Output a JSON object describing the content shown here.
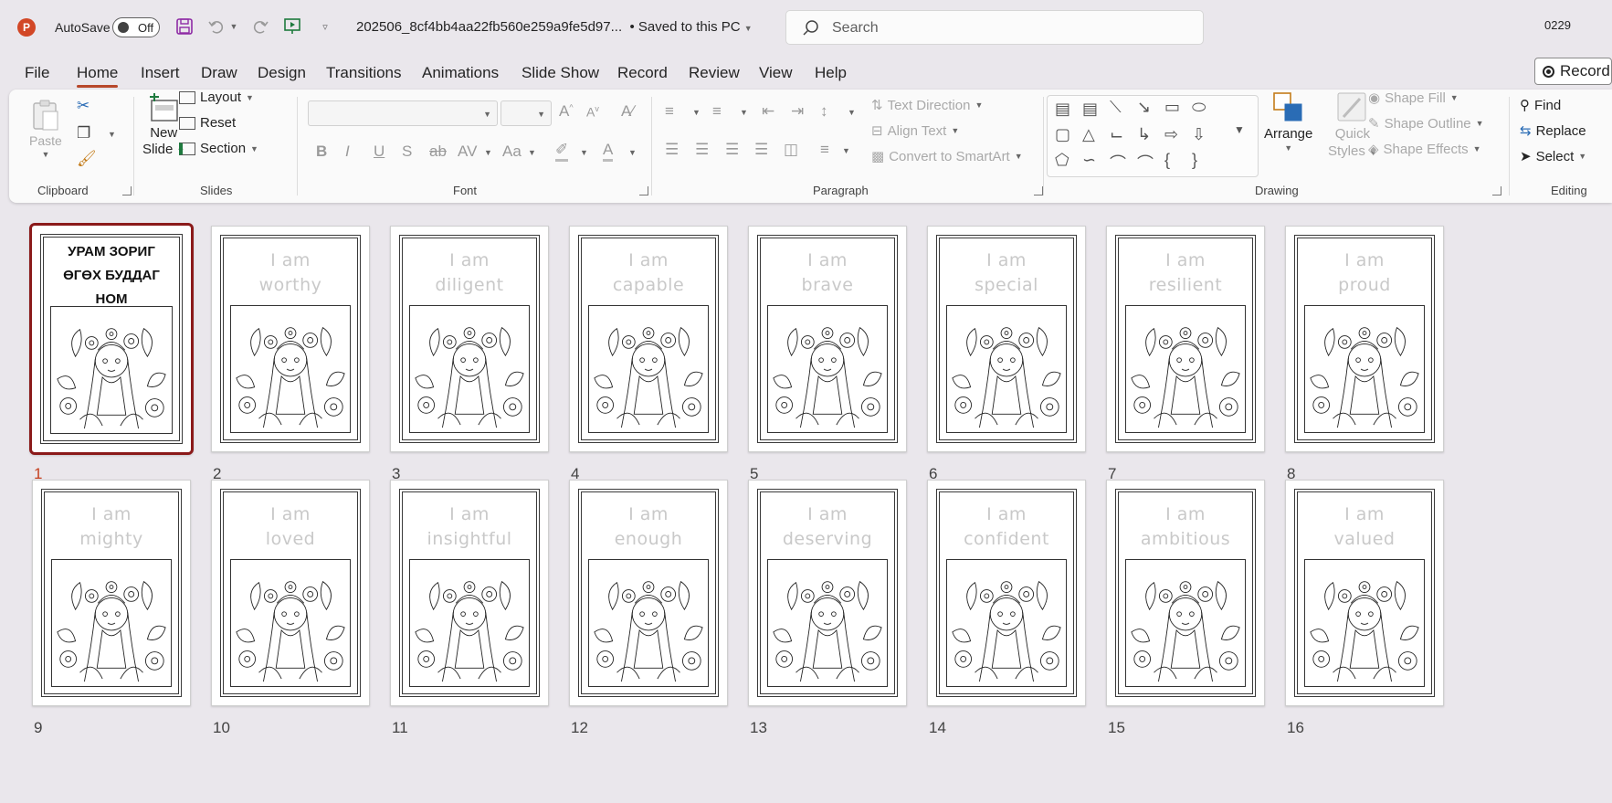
{
  "titlebar": {
    "autosave_label": "AutoSave",
    "autosave_state": "Off",
    "doc_title": "202506_8cf4bb4aa22fb560e259a9fe5d97...",
    "save_status": "Saved to this PC",
    "search_placeholder": "Search",
    "user": "0229"
  },
  "menu": {
    "tabs": [
      "File",
      "Home",
      "Insert",
      "Draw",
      "Design",
      "Transitions",
      "Animations",
      "Slide Show",
      "Record",
      "Review",
      "View",
      "Help"
    ],
    "record_button": "Record"
  },
  "ribbon": {
    "clipboard": {
      "paste": "Paste",
      "label": "Clipboard"
    },
    "slides": {
      "new_slide_1": "New",
      "new_slide_2": "Slide",
      "layout": "Layout",
      "reset": "Reset",
      "section": "Section",
      "label": "Slides"
    },
    "font": {
      "bold": "B",
      "italic": "I",
      "underline": "U",
      "shadow": "S",
      "strike": "ab",
      "spacing": "AV",
      "case": "Aa",
      "label": "Font"
    },
    "paragraph": {
      "text_direction": "Text Direction",
      "align_text": "Align Text",
      "convert_smartart": "Convert to SmartArt",
      "label": "Paragraph"
    },
    "drawing": {
      "arrange": "Arrange",
      "quick_styles_1": "Quick",
      "quick_styles_2": "Styles",
      "shape_fill": "Shape Fill",
      "shape_outline": "Shape Outline",
      "shape_effects": "Shape Effects",
      "label": "Drawing"
    },
    "editing": {
      "find": "Find",
      "replace": "Replace",
      "select": "Select",
      "label": "Editing"
    }
  },
  "slides": [
    {
      "num": "1",
      "lines": [
        "УРАМ ЗОРИГ",
        "ӨГӨХ БУДДАГ",
        "НОМ"
      ],
      "selected": true
    },
    {
      "num": "2",
      "lines": [
        "I am",
        "worthy"
      ]
    },
    {
      "num": "3",
      "lines": [
        "I am",
        "diligent"
      ]
    },
    {
      "num": "4",
      "lines": [
        "I am",
        "capable"
      ]
    },
    {
      "num": "5",
      "lines": [
        "I am",
        "brave"
      ]
    },
    {
      "num": "6",
      "lines": [
        "I am",
        "special"
      ]
    },
    {
      "num": "7",
      "lines": [
        "I am",
        "resilient"
      ]
    },
    {
      "num": "8",
      "lines": [
        "I am",
        "proud"
      ]
    },
    {
      "num": "9",
      "lines": [
        "I am",
        "mighty"
      ]
    },
    {
      "num": "10",
      "lines": [
        "I am",
        "loved"
      ]
    },
    {
      "num": "11",
      "lines": [
        "I am",
        "insightful"
      ]
    },
    {
      "num": "12",
      "lines": [
        "I am",
        "enough"
      ]
    },
    {
      "num": "13",
      "lines": [
        "I am",
        "deserving"
      ]
    },
    {
      "num": "14",
      "lines": [
        "I am",
        "confident"
      ]
    },
    {
      "num": "15",
      "lines": [
        "I am",
        "ambitious"
      ]
    },
    {
      "num": "16",
      "lines": [
        "I am",
        "valued"
      ]
    }
  ],
  "colors": {
    "accent": "#b7472a",
    "selected_border": "#8b1a1a",
    "slide_number_selected": "#c43e1c"
  }
}
